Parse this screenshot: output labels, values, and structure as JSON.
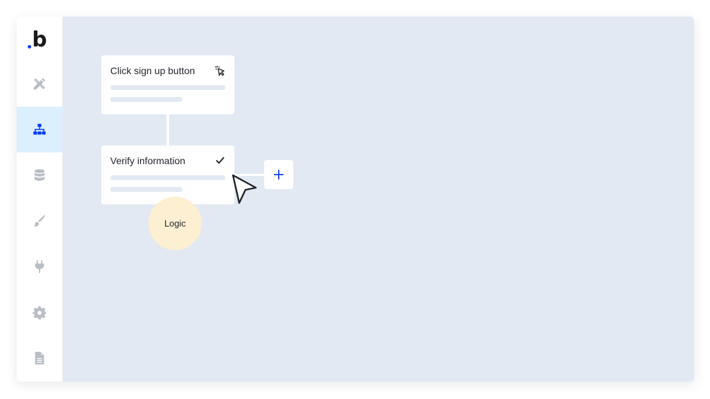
{
  "brand": {
    "logo_text": "b",
    "accent": "#0a3cff"
  },
  "sidebar": {
    "items": [
      {
        "name": "design",
        "icon": "pencil-ruler-icon",
        "active": false
      },
      {
        "name": "workflow",
        "icon": "sitemap-icon",
        "active": true
      },
      {
        "name": "data",
        "icon": "database-icon",
        "active": false
      },
      {
        "name": "styles",
        "icon": "paintbrush-icon",
        "active": false
      },
      {
        "name": "plugins",
        "icon": "plug-icon",
        "active": false
      },
      {
        "name": "settings",
        "icon": "gear-icon",
        "active": false
      },
      {
        "name": "logs",
        "icon": "document-icon",
        "active": false
      }
    ]
  },
  "workflow": {
    "step1": {
      "title": "Click sign up button",
      "icon": "click-cursor-icon"
    },
    "step2": {
      "title": "Verify information",
      "icon": "checkmark-icon"
    },
    "add_button": {
      "label": "+"
    },
    "logic_badge": {
      "label": "Logic"
    }
  },
  "colors": {
    "canvas": "#e3e9f2",
    "active_nav": "#dcefff",
    "icon_active": "#0a3cff",
    "icon_inactive": "#b9bec6",
    "logic": "#fdefd1"
  }
}
